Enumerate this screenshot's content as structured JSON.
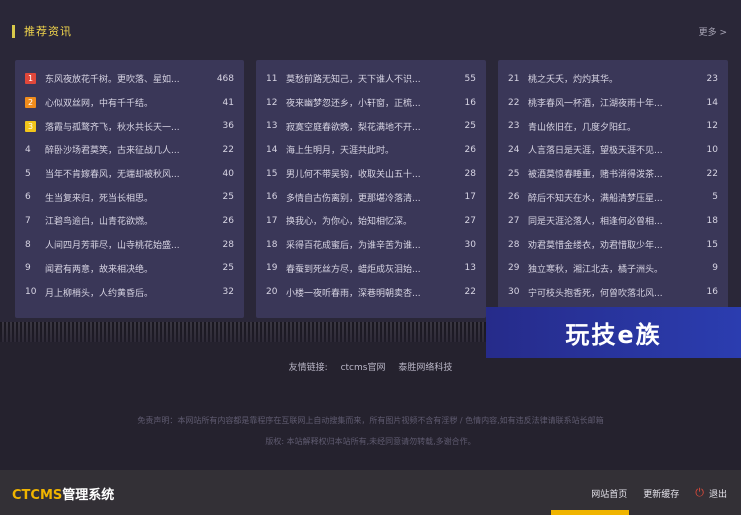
{
  "section": {
    "title": "推荐资讯",
    "more": "更多 >"
  },
  "colors": {
    "rank1": "#e0473a",
    "rank2": "#f08c1c",
    "rank3": "#f2c51a",
    "accent": "#f0d44c",
    "brand": "#f0b400"
  },
  "columns": [
    [
      {
        "rank": "1",
        "title": "东风夜放花千树。更吹落、星如...",
        "count": "468",
        "badge": "rank1"
      },
      {
        "rank": "2",
        "title": "心似双丝网，中有千千结。",
        "count": "41",
        "badge": "rank2"
      },
      {
        "rank": "3",
        "title": "落霞与孤鹜齐飞，秋水共长天一...",
        "count": "36",
        "badge": "rank3"
      },
      {
        "rank": "4",
        "title": "醉卧沙场君莫笑，古来征战几人...",
        "count": "22"
      },
      {
        "rank": "5",
        "title": "当年不肯嫁春风，无端却被秋风...",
        "count": "40"
      },
      {
        "rank": "6",
        "title": "生当复来归，死当长相思。",
        "count": "25"
      },
      {
        "rank": "7",
        "title": "江碧鸟逾白，山青花欲燃。",
        "count": "26"
      },
      {
        "rank": "8",
        "title": "人间四月芳菲尽，山寺桃花始盛...",
        "count": "28"
      },
      {
        "rank": "9",
        "title": "闻君有两意，故来相决绝。",
        "count": "25"
      },
      {
        "rank": "10",
        "title": "月上柳梢头，人约黄昏后。",
        "count": "32"
      }
    ],
    [
      {
        "rank": "11",
        "title": "莫愁前路无知己，天下谁人不识...",
        "count": "55"
      },
      {
        "rank": "12",
        "title": "夜来幽梦忽还乡，小轩窗，正梳...",
        "count": "16"
      },
      {
        "rank": "13",
        "title": "寂寞空庭春欲晚，梨花满地不开...",
        "count": "25"
      },
      {
        "rank": "14",
        "title": "海上生明月，天涯共此时。",
        "count": "26"
      },
      {
        "rank": "15",
        "title": "男儿何不带吴钩，收取关山五十...",
        "count": "28"
      },
      {
        "rank": "16",
        "title": "多情自古伤离别，更那堪冷落清...",
        "count": "17"
      },
      {
        "rank": "17",
        "title": "换我心，为你心，始知相忆深。",
        "count": "27"
      },
      {
        "rank": "18",
        "title": "采得百花成蜜后，为谁辛苦为谁...",
        "count": "30"
      },
      {
        "rank": "19",
        "title": "春蚕到死丝方尽，蜡炬成灰泪始...",
        "count": "13"
      },
      {
        "rank": "20",
        "title": "小楼一夜听春雨，深巷明朝卖杏...",
        "count": "22"
      }
    ],
    [
      {
        "rank": "21",
        "title": "桃之夭夭，灼灼其华。",
        "count": "23"
      },
      {
        "rank": "22",
        "title": "桃李春风一杯酒，江湖夜雨十年...",
        "count": "14"
      },
      {
        "rank": "23",
        "title": "青山依旧在，几度夕阳红。",
        "count": "12"
      },
      {
        "rank": "24",
        "title": "人言落日是天涯，望极天涯不见...",
        "count": "10"
      },
      {
        "rank": "25",
        "title": "被酒莫惊春睡重，赌书消得泼茶...",
        "count": "22"
      },
      {
        "rank": "26",
        "title": "醉后不知天在水，满船清梦压星...",
        "count": "5"
      },
      {
        "rank": "27",
        "title": "同是天涯沦落人，相逢何必曾相...",
        "count": "18"
      },
      {
        "rank": "28",
        "title": "劝君莫惜金缕衣，劝君惜取少年...",
        "count": "15"
      },
      {
        "rank": "29",
        "title": "独立寒秋，湘江北去，橘子洲头。",
        "count": "9"
      },
      {
        "rank": "30",
        "title": "宁可枝头抱香死，何曾吹落北风...",
        "count": "16"
      }
    ]
  ],
  "watermark": {
    "text": "玩技e族"
  },
  "footer": {
    "links_label": "友情链接:",
    "links": [
      "ctcms官网",
      "泰胜网络科技"
    ],
    "disclaimer1": "免责声明：本网站所有内容都是靠程序在互联网上自动搜集而来，所有图片视频不含有淫秽 / 色情内容,如有违反法律请联系站长邮箱",
    "disclaimer2": "版权: 本站解释权归本站所有,未经同意请勿转载,多谢合作。"
  },
  "admin": {
    "brand_hl": "CTCMS",
    "brand_rest": "管理系统",
    "nav": [
      "网站首页",
      "更新缓存",
      "退出"
    ]
  }
}
